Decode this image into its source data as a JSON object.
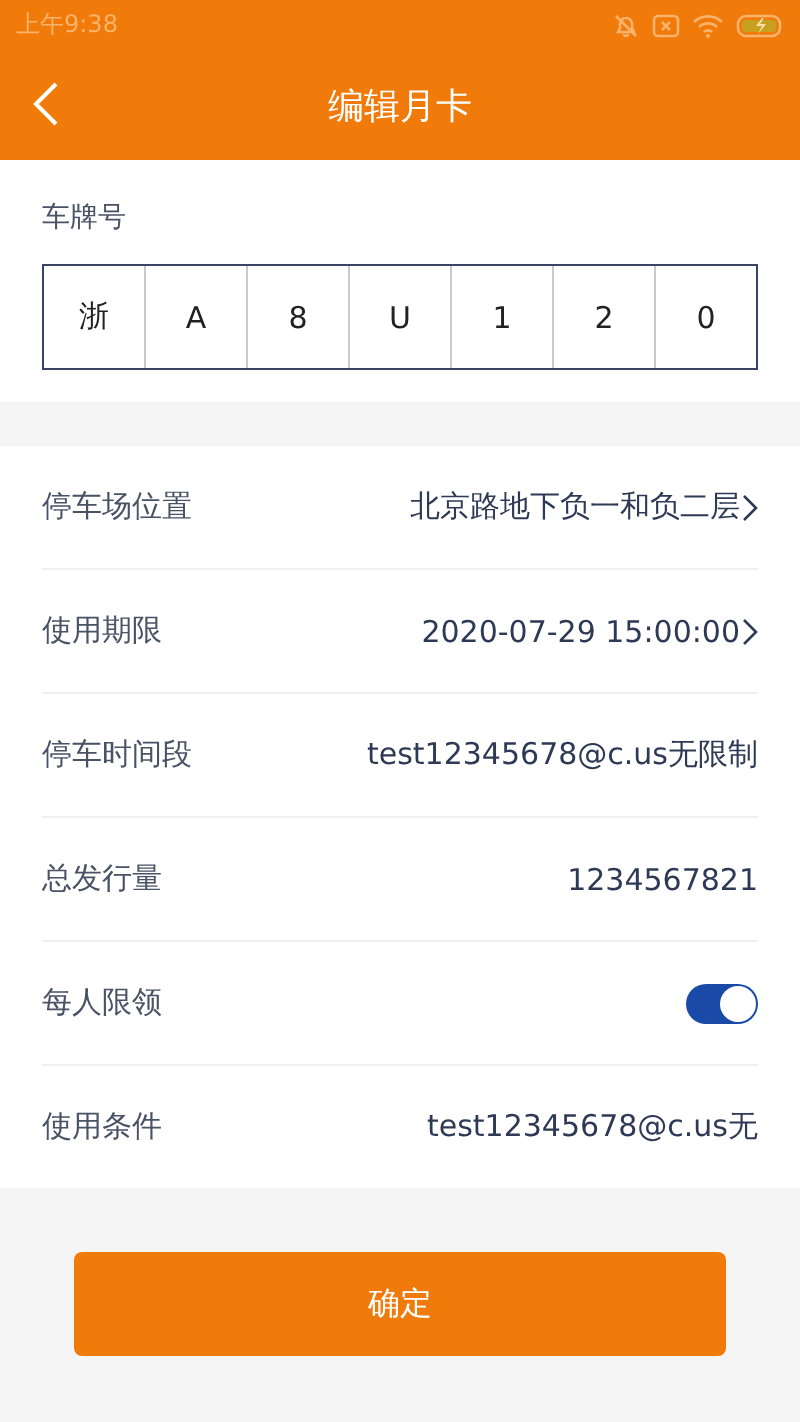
{
  "status_bar": {
    "time": "上午9:38",
    "battery_charging": true
  },
  "header": {
    "title": "编辑月卡",
    "back": true
  },
  "plate": {
    "label": "车牌号",
    "chars": [
      "浙",
      "A",
      "8",
      "U",
      "1",
      "2",
      "0"
    ]
  },
  "rows": [
    {
      "kind": "link",
      "label": "停车场位置",
      "value": "北京路地下负一和负二层"
    },
    {
      "kind": "link",
      "label": "使用期限",
      "value": "2020-07-29 15:00:00"
    },
    {
      "kind": "text",
      "label": "停车时间段",
      "value": "test12345678@c.us无限制"
    },
    {
      "kind": "text",
      "label": "总发行量",
      "value": "1234567821"
    },
    {
      "kind": "toggle",
      "label": "每人限领",
      "on": true
    },
    {
      "kind": "text",
      "label": "使用条件",
      "value": "test12345678@c.us无"
    }
  ],
  "confirm_button": "确定"
}
